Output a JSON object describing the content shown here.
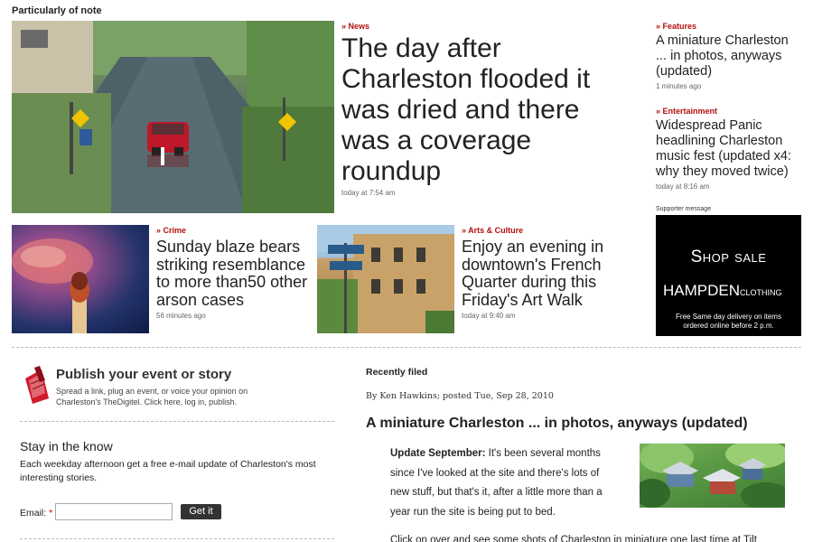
{
  "section_title": "Particularly of note",
  "lead": {
    "kicker": "News",
    "headline_lines": [
      "The day after",
      "Charleston flooded it",
      "was dried and there",
      "was a coverage",
      "roundup"
    ],
    "timestamp": "today at 7:54 am"
  },
  "sidebar": {
    "features": {
      "kicker": "Features",
      "headline_lines": [
        "A miniature Charleston",
        "... in photos, anyways",
        "(updated)"
      ],
      "timestamp": "1 minutes ago"
    },
    "entertainment": {
      "kicker": "Entertainment",
      "headline_lines": [
        "Widespread Panic",
        "headlining Charleston",
        "music fest (updated x4:",
        "why they moved twice)"
      ],
      "timestamp": "today at 8:16 am"
    },
    "supporter_label": "Supporter message",
    "ad": {
      "line1": "Shop sale",
      "brand": "HAMPDEN",
      "brand_suffix": "CLOTHING",
      "note_lines": [
        "Free Same day delivery on items",
        "ordered online before 2 p.m."
      ]
    }
  },
  "crime": {
    "kicker": "Crime",
    "headline_lines": [
      "Sunday blaze bears",
      "striking resemblance",
      "to more than50 other",
      "arson cases"
    ],
    "timestamp": "56 minutes ago"
  },
  "arts": {
    "kicker": "Arts & Culture",
    "headline_lines": [
      "Enjoy an evening in",
      "downtown's French",
      "Quarter during this",
      "Friday's Art Walk"
    ],
    "timestamp": "today at 9:40 am"
  },
  "publish": {
    "title": "Publish your event or story",
    "desc_lines": [
      "Spread a link, plug an event, or voice your opinion on",
      "Charleston's TheDigitel. Click here, log in, publish."
    ]
  },
  "newsletter": {
    "title": "Stay in the know",
    "desc_lines": [
      "Each weekday afternoon get a free e-mail update of Charleston's most",
      "interesting stories."
    ],
    "email_label": "Email:",
    "required_mark": "*",
    "button_label": "Get it"
  },
  "recent": {
    "title": "Recently filed",
    "byline": "By Ken Hawkins; posted Tue, Sep 28, 2010",
    "headline": "A miniature Charleston ... in photos, anyways (updated)",
    "lead_bold": "Update September:",
    "body_lines": [
      " It's been several months",
      "since I've looked at the site and there's lots of",
      "new stuff, but that's it, after a little more than a",
      "year run the site is being put to bed."
    ],
    "next_line": "Click on over and see some shots of Charleston in miniature one last time at Tilt"
  }
}
